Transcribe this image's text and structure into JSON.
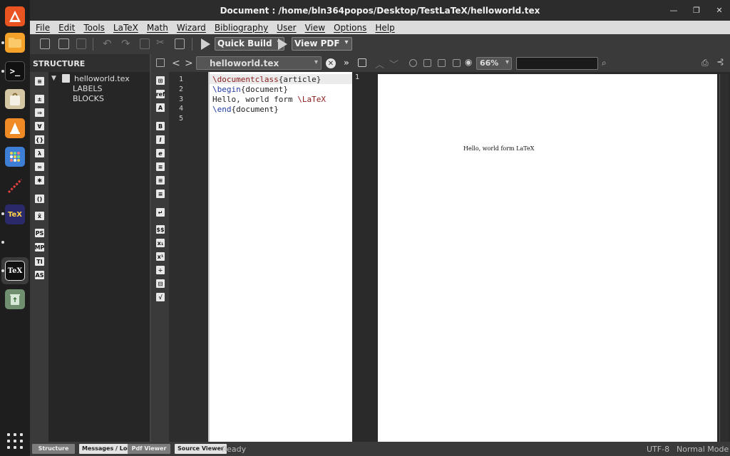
{
  "window": {
    "title": "Document : /home/bln364popos/Desktop/TestLaTeX/helloworld.tex"
  },
  "menu": [
    "File",
    "Edit",
    "Tools",
    "LaTeX",
    "Math",
    "Wizard",
    "Bibliography",
    "User",
    "View",
    "Options",
    "Help"
  ],
  "toolbar": {
    "quick_build": "Quick Build",
    "view_pdf": "View PDF"
  },
  "structure": {
    "header": "STRUCTURE",
    "file": "helloworld.tex",
    "items": [
      "LABELS",
      "BLOCKS"
    ],
    "side_icons": [
      "PS",
      "MP",
      "TI",
      "AS"
    ]
  },
  "editor": {
    "tab_file": "helloworld.tex",
    "line_numbers": [
      "1",
      "2",
      "3",
      "4",
      "5"
    ],
    "code": {
      "l1_cmd": "\\documentclass",
      "l1_arg": "{article}",
      "l2_cmd": "\\begin",
      "l2_arg": "{document}",
      "l3_text": "Hello, world form ",
      "l3_cmd": "\\LaTeX",
      "l4_cmd": "\\end",
      "l4_arg": "{document}"
    }
  },
  "pdf": {
    "zoom": "66%",
    "page_number": "1",
    "rendered_text": "Hello, world form LaTeX"
  },
  "statusbar": {
    "tabs": [
      "Structure",
      "Messages / Log",
      "Pdf Viewer",
      "Source Viewer"
    ],
    "status": "Ready",
    "encoding": "UTF-8",
    "mode": "Normal Mode"
  },
  "dock": {
    "texstudio_label": "TeX"
  },
  "colors": {
    "accent_orange": "#f08a24",
    "command_red": "#8b1a1a",
    "command_blue": "#1f3aa3"
  }
}
